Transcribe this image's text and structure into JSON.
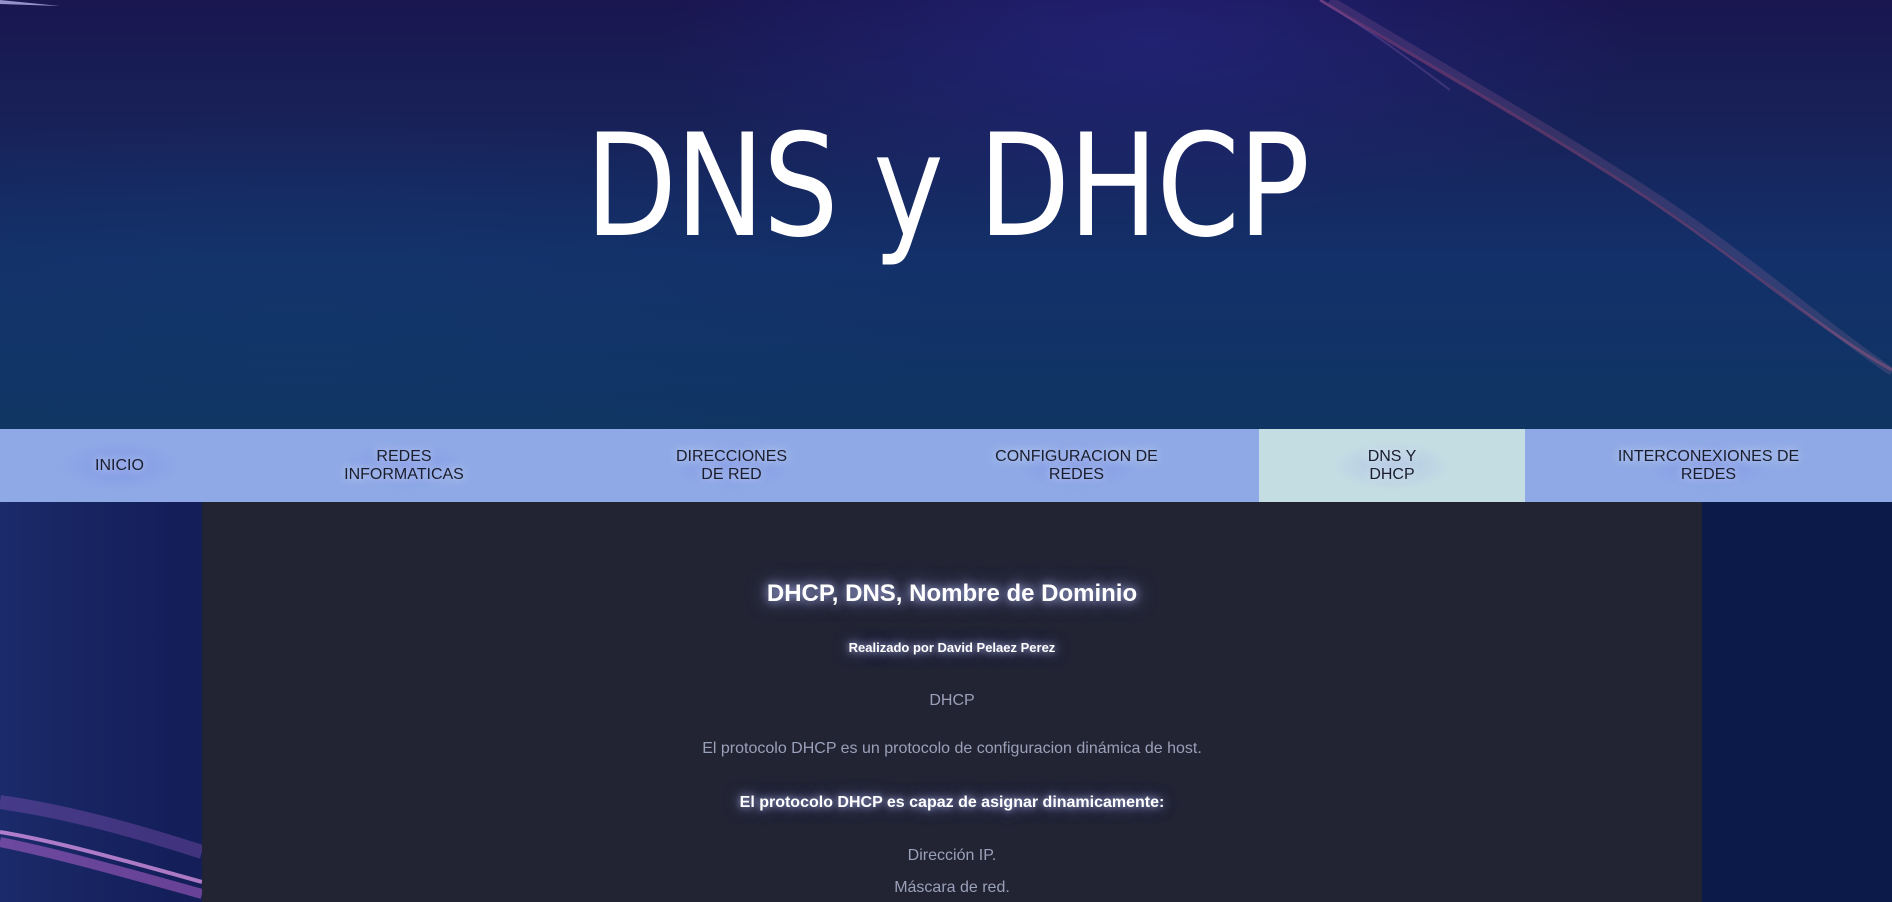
{
  "header": {
    "title": "DNS y DHCP"
  },
  "nav": {
    "items": [
      {
        "label": "INICIO",
        "active": false
      },
      {
        "label": "REDES\nINFORMATICAS",
        "active": false
      },
      {
        "label": "DIRECCIONES\nDE RED",
        "active": false
      },
      {
        "label": "CONFIGURACION DE\nREDES",
        "active": false
      },
      {
        "label": "DNS Y\nDHCP",
        "active": true
      },
      {
        "label": "INTERCONEXIONES DE\nREDES",
        "active": false
      }
    ]
  },
  "content": {
    "heading": "DHCP, DNS, Nombre de Dominio",
    "author": "Realizado por David Pelaez Perez",
    "section_title": "DHCP",
    "intro": "El protocolo DHCP es un protocolo de configuracion dinámica de host.",
    "capable_heading": "El protocolo DHCP es capaz de asignar dinamicamente:",
    "items": [
      "Dirección IP.",
      "Máscara de red."
    ]
  },
  "colors": {
    "nav_background": "#8ea9e6",
    "nav_active": "#c4dde3",
    "content_background": "#222434",
    "hero_top": "#191650",
    "hero_bottom": "#0f3562"
  }
}
